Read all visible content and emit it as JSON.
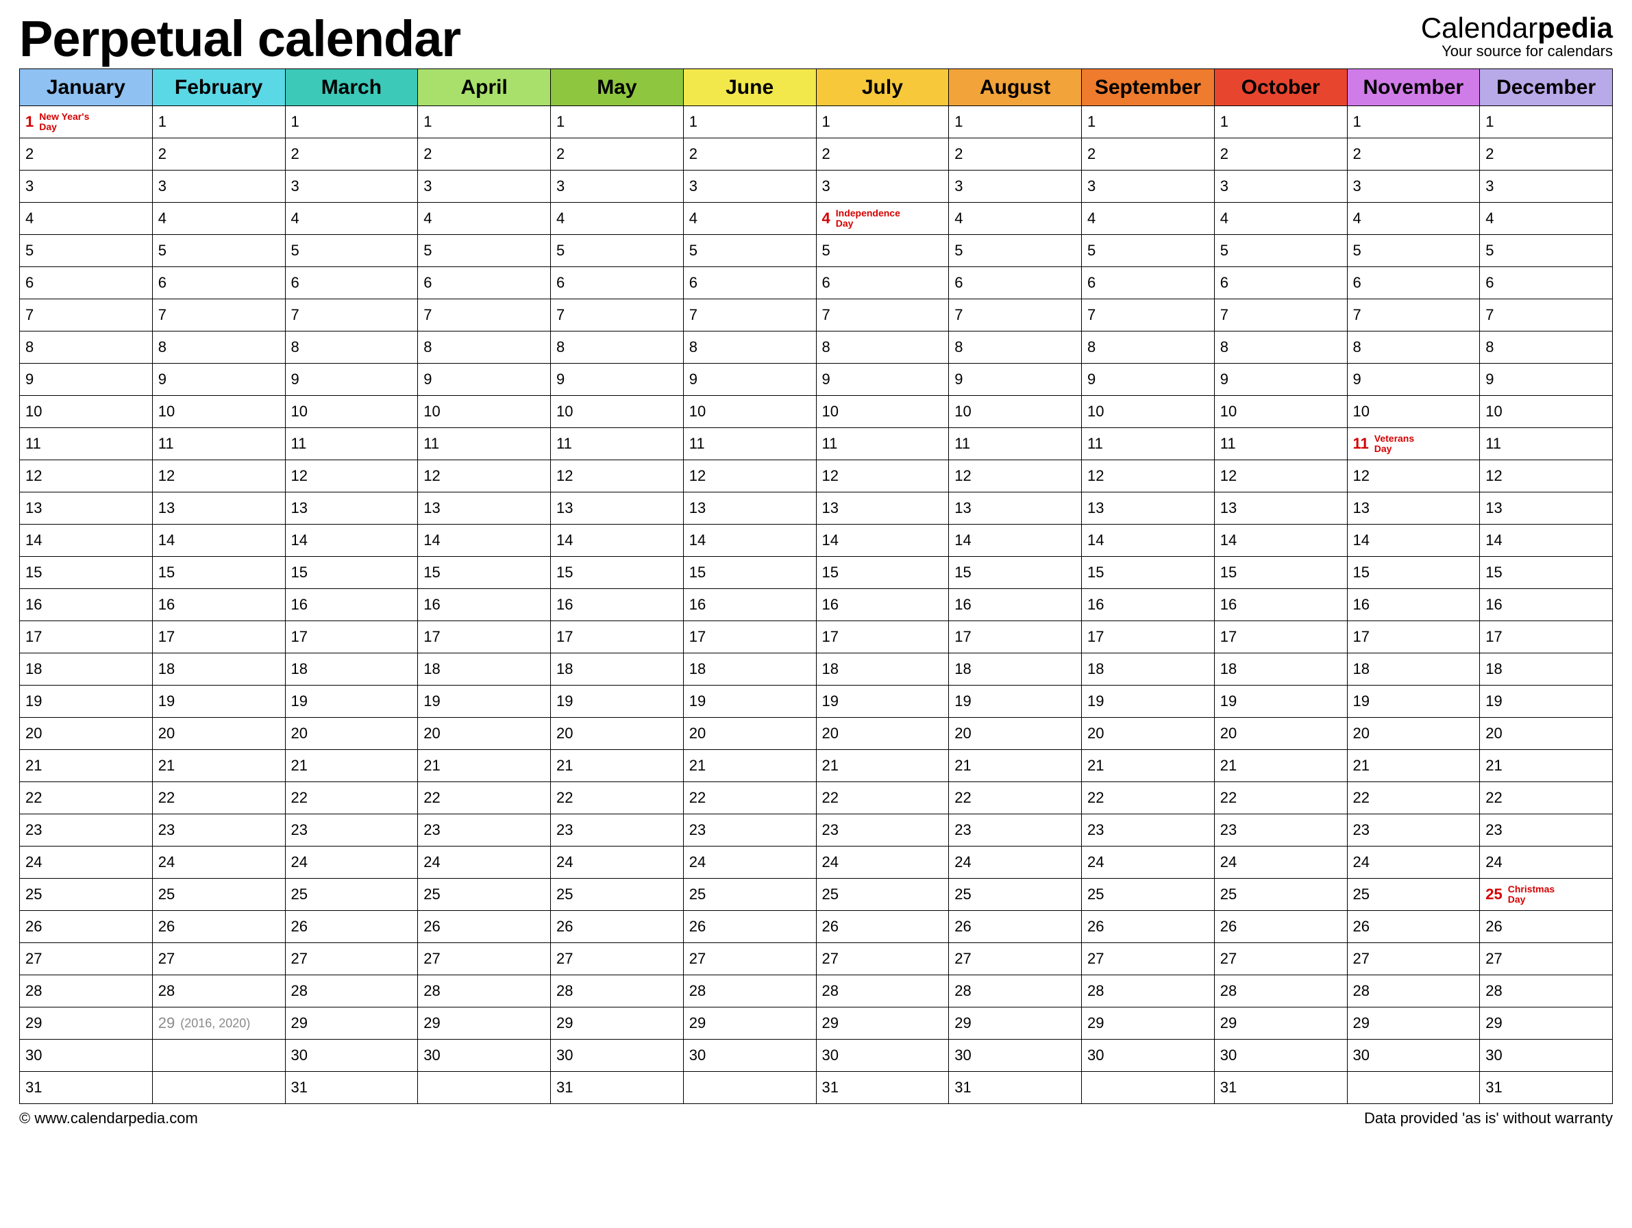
{
  "title": "Perpetual calendar",
  "brand": {
    "prefix": "Calendar",
    "bold": "pedia",
    "sub": "Your source for calendars"
  },
  "footer": {
    "left": "© www.calendarpedia.com",
    "right": "Data provided 'as is' without warranty"
  },
  "months": [
    {
      "key": "jan",
      "name": "January",
      "color": "#8fc1f2",
      "days": 31
    },
    {
      "key": "feb",
      "name": "February",
      "color": "#5bd8e6",
      "days": 28
    },
    {
      "key": "mar",
      "name": "March",
      "color": "#3cc9b8",
      "days": 31
    },
    {
      "key": "apr",
      "name": "April",
      "color": "#a8e06b",
      "days": 30
    },
    {
      "key": "may",
      "name": "May",
      "color": "#8fc63f",
      "days": 31
    },
    {
      "key": "jun",
      "name": "June",
      "color": "#f2e84b",
      "days": 30
    },
    {
      "key": "jul",
      "name": "July",
      "color": "#f7c93a",
      "days": 31
    },
    {
      "key": "aug",
      "name": "August",
      "color": "#f2a33a",
      "days": 31
    },
    {
      "key": "sep",
      "name": "September",
      "color": "#ef7b2e",
      "days": 30
    },
    {
      "key": "oct",
      "name": "October",
      "color": "#e8452f",
      "days": 31
    },
    {
      "key": "nov",
      "name": "November",
      "color": "#d07ce8",
      "days": 30
    },
    {
      "key": "dec",
      "name": "December",
      "color": "#b8a9e8",
      "days": 31
    }
  ],
  "max_days": 31,
  "leap": {
    "month": "feb",
    "day": 29,
    "note": "(2016, 2020)"
  },
  "holidays": [
    {
      "month": "jan",
      "day": 1,
      "label": "New Year's Day"
    },
    {
      "month": "jul",
      "day": 4,
      "label": "Independence Day"
    },
    {
      "month": "nov",
      "day": 11,
      "label": "Veterans Day"
    },
    {
      "month": "dec",
      "day": 25,
      "label": "Christmas Day"
    }
  ]
}
